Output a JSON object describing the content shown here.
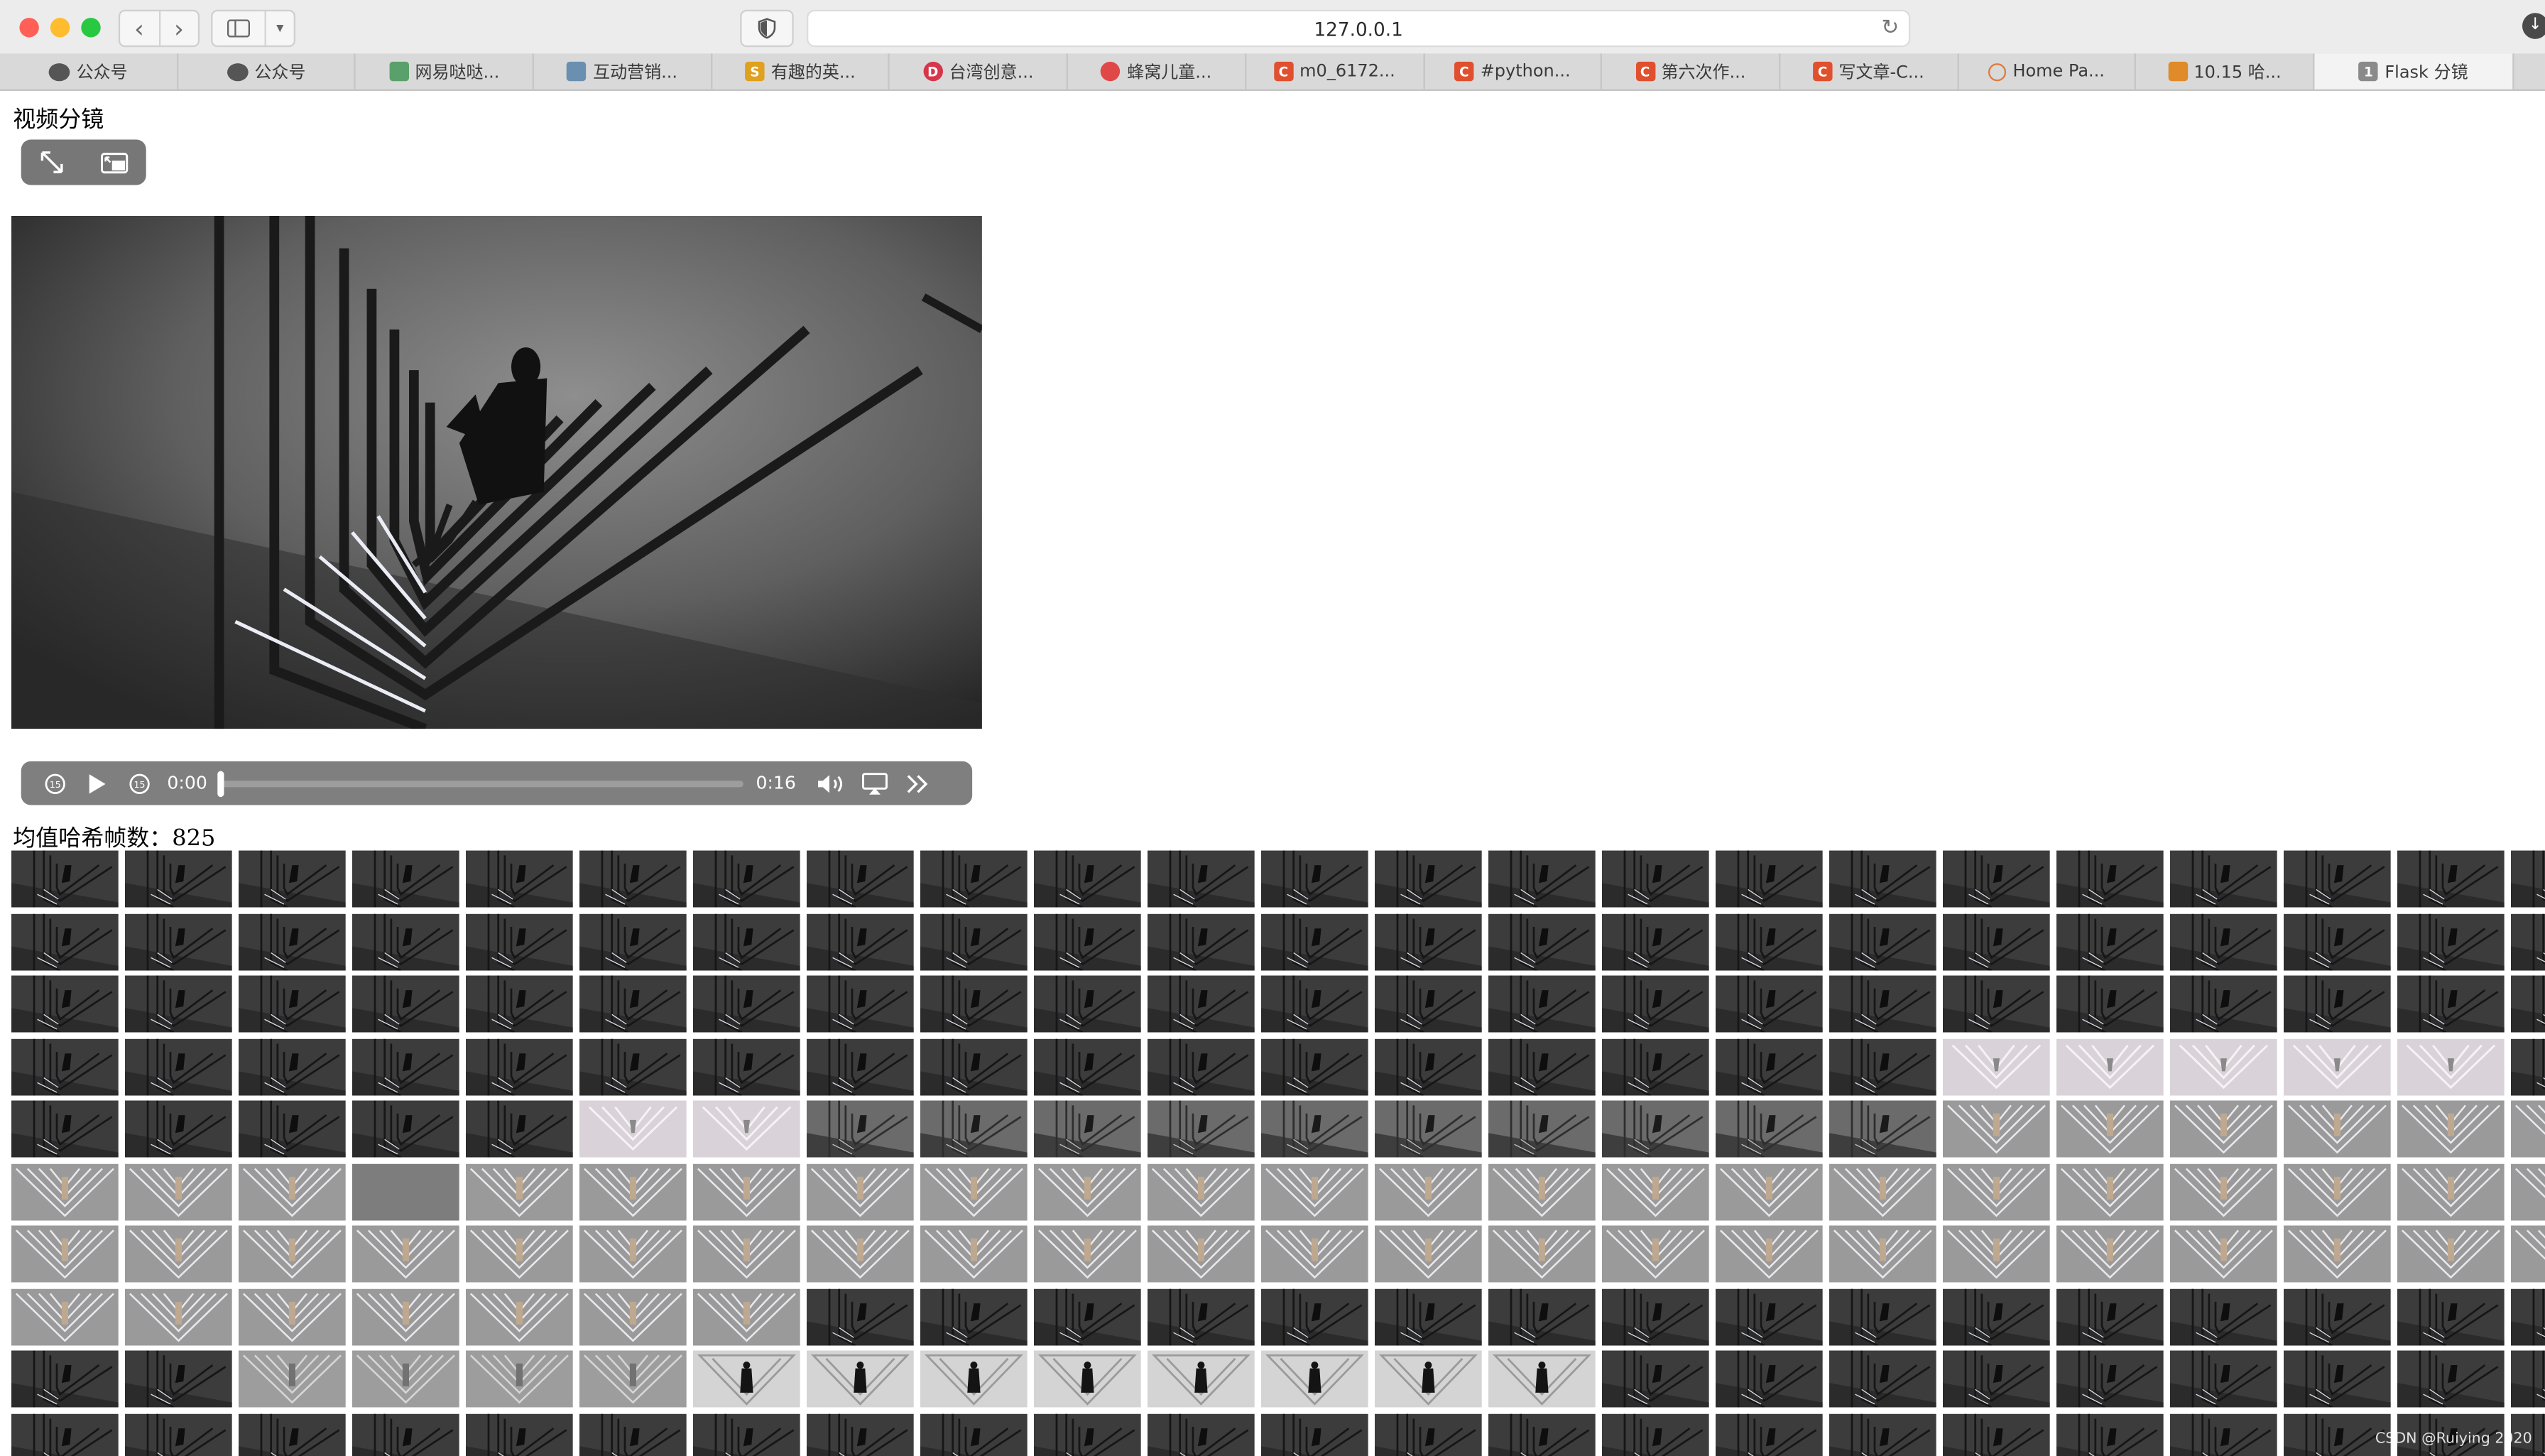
{
  "browser": {
    "url": "127.0.0.1",
    "tabs": [
      {
        "label": "公众号",
        "icon": "wechat-icon",
        "color": "#555555"
      },
      {
        "label": "公众号",
        "icon": "wechat-icon",
        "color": "#555555"
      },
      {
        "label": "网易哒哒...",
        "icon": "green-square-icon",
        "color": "#5aa06a"
      },
      {
        "label": "互动营销...",
        "icon": "feather-icon",
        "color": "#6a8fb0"
      },
      {
        "label": "有趣的英...",
        "icon": "s-logo-icon",
        "color": "#e0a020"
      },
      {
        "label": "台湾创意...",
        "icon": "d-logo-icon",
        "color": "#d8344a"
      },
      {
        "label": "蜂窝儿童...",
        "icon": "red-circle-icon",
        "color": "#e04848"
      },
      {
        "label": "m0_6172...",
        "icon": "csdn-icon",
        "color": "#e0502e"
      },
      {
        "label": "#python...",
        "icon": "csdn-icon",
        "color": "#e0502e"
      },
      {
        "label": "第六次作...",
        "icon": "csdn-icon",
        "color": "#e0502e"
      },
      {
        "label": "写文章-C...",
        "icon": "csdn-icon",
        "color": "#e0502e"
      },
      {
        "label": "Home Pa...",
        "icon": "loading-ring-icon",
        "color": "#e07a3a"
      },
      {
        "label": "10.15 哈...",
        "icon": "book-icon",
        "color": "#e08a2a"
      },
      {
        "label": "Flask 分镜",
        "icon": "number-one-icon",
        "color": "#8a8a8a",
        "active": true
      }
    ]
  },
  "page": {
    "title": "视频分镜",
    "hash_label": "均值哈希帧数：825",
    "watermark": "CSDN @Ruiying 2020"
  },
  "video": {
    "current_time": "0:00",
    "duration": "0:16",
    "progress": 0
  },
  "frames": {
    "columns": 23,
    "rows": 10,
    "row_kinds": [
      [
        "D",
        "D",
        "D",
        "D",
        "D",
        "D",
        "D",
        "D",
        "D",
        "D",
        "D",
        "D",
        "D",
        "D",
        "D",
        "D",
        "D",
        "D",
        "D",
        "D",
        "D",
        "D",
        "D"
      ],
      [
        "D",
        "D",
        "D",
        "D",
        "D",
        "D",
        "D",
        "D",
        "D",
        "D",
        "D",
        "D",
        "D",
        "D",
        "D",
        "D",
        "D",
        "D",
        "D",
        "D",
        "D",
        "D",
        "D"
      ],
      [
        "D",
        "D",
        "D",
        "D",
        "D",
        "D",
        "D",
        "D",
        "D",
        "D",
        "D",
        "D",
        "D",
        "D",
        "D",
        "D",
        "D",
        "D",
        "D",
        "D",
        "D",
        "D",
        "D"
      ],
      [
        "D",
        "D",
        "D",
        "D",
        "D",
        "D",
        "D",
        "D",
        "D",
        "D",
        "D",
        "D",
        "D",
        "D",
        "D",
        "D",
        "D",
        "W",
        "W",
        "W",
        "W",
        "W",
        "D"
      ],
      [
        "D",
        "D",
        "D",
        "D",
        "D",
        "W",
        "W",
        "C",
        "C",
        "C",
        "C",
        "C",
        "C",
        "C",
        "C",
        "C",
        "C",
        "L",
        "L",
        "L",
        "L",
        "L",
        "L"
      ],
      [
        "L",
        "L",
        "L",
        "G",
        "L",
        "L",
        "L",
        "L",
        "L",
        "L",
        "L",
        "L",
        "L",
        "L",
        "L",
        "L",
        "L",
        "L",
        "L",
        "L",
        "L",
        "L",
        "L"
      ],
      [
        "L",
        "L",
        "L",
        "L",
        "L",
        "L",
        "L",
        "L",
        "L",
        "L",
        "L",
        "L",
        "L",
        "L",
        "L",
        "L",
        "L",
        "L",
        "L",
        "L",
        "L",
        "L",
        "L"
      ],
      [
        "L",
        "L",
        "L",
        "L",
        "L",
        "L",
        "L",
        "D",
        "D",
        "D",
        "D",
        "D",
        "D",
        "D",
        "D",
        "D",
        "D",
        "D",
        "D",
        "D",
        "D",
        "D",
        "D"
      ],
      [
        "D",
        "D",
        "M",
        "M",
        "M",
        "M",
        "P",
        "P",
        "P",
        "P",
        "P",
        "P",
        "P",
        "P",
        "D",
        "D",
        "D",
        "D",
        "D",
        "D",
        "D",
        "D",
        "D"
      ],
      [
        "D",
        "D",
        "D",
        "D",
        "D",
        "D",
        "D",
        "D",
        "D",
        "D",
        "D",
        "D",
        "D",
        "D",
        "D",
        "D",
        "D",
        "D",
        "D",
        "D",
        "D",
        "D",
        "D"
      ]
    ]
  },
  "colors": {
    "chrome": "#ececec",
    "tabs_bg": "#d9d9d9",
    "controls": "#7f7f7f"
  }
}
